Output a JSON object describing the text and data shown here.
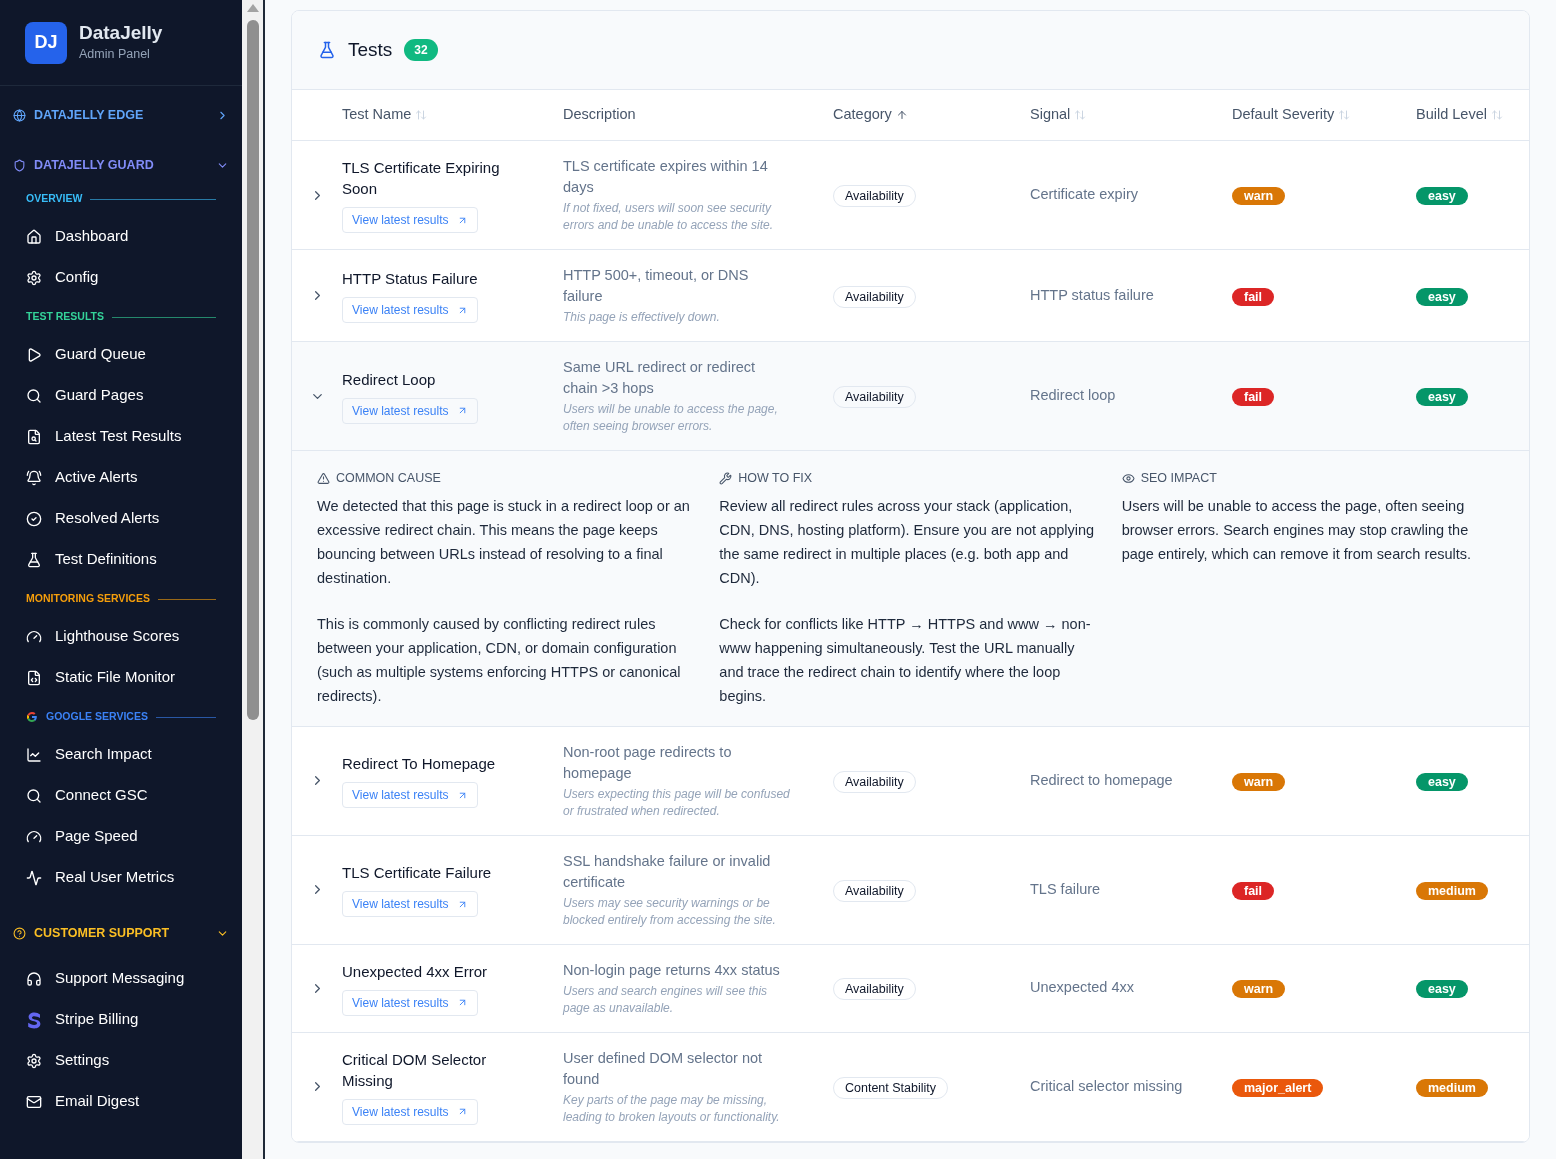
{
  "sidebar": {
    "brand": {
      "initials": "DJ",
      "name": "DataJelly",
      "subtitle": "Admin Panel"
    },
    "groups": [
      {
        "label": "DATAJELLY EDGE",
        "expanded": false,
        "color": "#60a5fa"
      },
      {
        "label": "DATAJELLY GUARD",
        "expanded": true,
        "color": "#818cf8",
        "sections": [
          {
            "label": "OVERVIEW",
            "color": "#38bdf8",
            "items": [
              {
                "label": "Dashboard"
              },
              {
                "label": "Config"
              }
            ]
          },
          {
            "label": "TEST RESULTS",
            "color": "#34d399",
            "items": [
              {
                "label": "Guard Queue"
              },
              {
                "label": "Guard Pages"
              },
              {
                "label": "Latest Test Results"
              },
              {
                "label": "Active Alerts"
              },
              {
                "label": "Resolved Alerts"
              },
              {
                "label": "Test Definitions"
              }
            ]
          },
          {
            "label": "MONITORING SERVICES",
            "color": "#f59e0b",
            "items": [
              {
                "label": "Lighthouse Scores"
              },
              {
                "label": "Static File Monitor"
              }
            ]
          },
          {
            "label": "GOOGLE SERVICES",
            "color": "#3b82f6",
            "items": [
              {
                "label": "Search Impact"
              },
              {
                "label": "Connect GSC"
              },
              {
                "label": "Page Speed"
              },
              {
                "label": "Real User Metrics"
              }
            ]
          }
        ]
      },
      {
        "label": "CUSTOMER SUPPORT",
        "expanded": true,
        "color": "#fbbf24",
        "sections": [
          {
            "items": [
              {
                "label": "Support Messaging"
              },
              {
                "label": "Stripe Billing"
              },
              {
                "label": "Settings"
              },
              {
                "label": "Email Digest"
              }
            ]
          }
        ]
      }
    ]
  },
  "panel": {
    "title": "Tests",
    "count": "32",
    "columns": [
      {
        "label": "Test Name",
        "sortable": true,
        "sorted": false
      },
      {
        "label": "Description",
        "sortable": false,
        "sorted": false
      },
      {
        "label": "Category",
        "sortable": true,
        "sorted": true
      },
      {
        "label": "Signal",
        "sortable": true,
        "sorted": false
      },
      {
        "label": "Default Severity",
        "sortable": true,
        "sorted": false
      },
      {
        "label": "Build Level",
        "sortable": true,
        "sorted": false
      }
    ],
    "rows": [
      {
        "name": "TLS Certificate Expiring Soon",
        "link": "View latest results",
        "description": "TLS certificate expires within 14 days",
        "impact": "If not fixed, users will soon see security errors and be unable to access the site.",
        "category": "Availability",
        "signal": "Certificate expiry",
        "severity": {
          "label": "warn",
          "color": "#d97706"
        },
        "build": {
          "label": "easy",
          "color": "#059669"
        },
        "expanded": false
      },
      {
        "name": "HTTP Status Failure",
        "link": "View latest results",
        "description": "HTTP 500+, timeout, or DNS failure",
        "impact": "This page is effectively down.",
        "category": "Availability",
        "signal": "HTTP status failure",
        "severity": {
          "label": "fail",
          "color": "#dc2626"
        },
        "build": {
          "label": "easy",
          "color": "#059669"
        },
        "expanded": false
      },
      {
        "name": "Redirect Loop",
        "link": "View latest results",
        "description": "Same URL redirect or redirect chain >3 hops",
        "impact": "Users will be unable to access the page, often seeing browser errors.",
        "category": "Availability",
        "signal": "Redirect loop",
        "severity": {
          "label": "fail",
          "color": "#dc2626"
        },
        "build": {
          "label": "easy",
          "color": "#059669"
        },
        "expanded": true,
        "details": [
          {
            "title": "COMMON CAUSE",
            "paragraphs": [
              "We detected that this page is stuck in a redirect loop or an excessive redirect chain. This means the page keeps bouncing between URLs instead of resolving to a final destination.",
              "This is commonly caused by conflicting redirect rules between your application, CDN, or domain configuration (such as multiple systems enforcing HTTPS or canonical redirects)."
            ]
          },
          {
            "title": "HOW TO FIX",
            "paragraphs": [
              "Review all redirect rules across your stack (application, CDN, DNS, hosting platform). Ensure you are not applying the same redirect in multiple places (e.g. both app and CDN).",
              "Check for conflicts like HTTP → HTTPS and www → non-www happening simultaneously. Test the URL manually and trace the redirect chain to identify where the loop begins."
            ]
          },
          {
            "title": "SEO IMPACT",
            "paragraphs": [
              "Users will be unable to access the page, often seeing browser errors. Search engines may stop crawling the page entirely, which can remove it from search results."
            ]
          }
        ]
      },
      {
        "name": "Redirect To Homepage",
        "link": "View latest results",
        "description": "Non-root page redirects to homepage",
        "impact": "Users expecting this page will be confused or frustrated when redirected.",
        "category": "Availability",
        "signal": "Redirect to homepage",
        "severity": {
          "label": "warn",
          "color": "#d97706"
        },
        "build": {
          "label": "easy",
          "color": "#059669"
        },
        "expanded": false
      },
      {
        "name": "TLS Certificate Failure",
        "link": "View latest results",
        "description": "SSL handshake failure or invalid certificate",
        "impact": "Users may see security warnings or be blocked entirely from accessing the site.",
        "category": "Availability",
        "signal": "TLS failure",
        "severity": {
          "label": "fail",
          "color": "#dc2626"
        },
        "build": {
          "label": "medium",
          "color": "#d97706"
        },
        "expanded": false
      },
      {
        "name": "Unexpected 4xx Error",
        "link": "View latest results",
        "description": "Non-login page returns 4xx status",
        "impact": "Users and search engines will see this page as unavailable.",
        "category": "Availability",
        "signal": "Unexpected 4xx",
        "severity": {
          "label": "warn",
          "color": "#d97706"
        },
        "build": {
          "label": "easy",
          "color": "#059669"
        },
        "expanded": false
      },
      {
        "name": "Critical DOM Selector Missing",
        "link": "View latest results",
        "description": "User defined DOM selector not found",
        "impact": "Key parts of the page may be missing, leading to broken layouts or functionality.",
        "category": "Content Stability",
        "signal": "Critical selector missing",
        "severity": {
          "label": "major_alert",
          "color": "#ea580c"
        },
        "build": {
          "label": "medium",
          "color": "#d97706"
        },
        "expanded": false
      }
    ]
  }
}
